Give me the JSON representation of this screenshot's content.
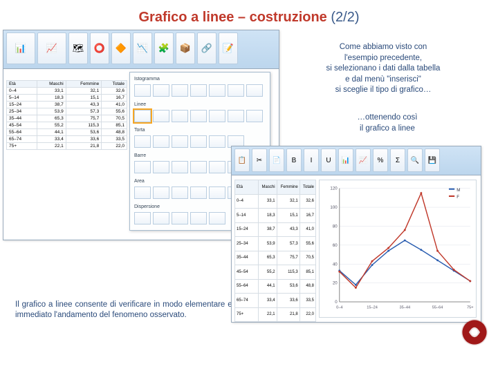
{
  "slide": {
    "title_main": "Grafico a linee – costruzione",
    "title_suffix": "(2/2)",
    "text1": "Come abbiamo visto con\nl'esempio precedente,\nsi selezionano i dati dalla tabella\ne dal menù \"inserisci\"\nsi sceglie il tipo di grafico…",
    "text2": "…ottenendo così\nil grafico a linee",
    "text3": "Il grafico a linee consente di verificare in modo elementare ed immediato l'andamento del fenomeno osservato."
  },
  "table": {
    "headers": [
      "Età",
      "Maschi",
      "Femmine",
      "Totale"
    ],
    "rows": [
      [
        "0–4",
        "33,1",
        "32,1",
        "32,6"
      ],
      [
        "5–14",
        "18,3",
        "15,1",
        "16,7"
      ],
      [
        "15–24",
        "38,7",
        "43,3",
        "41,0"
      ],
      [
        "25–34",
        "53,9",
        "57,3",
        "55,6"
      ],
      [
        "35–44",
        "65,3",
        "75,7",
        "70,5"
      ],
      [
        "45–54",
        "55,2",
        "115,3",
        "85,1"
      ],
      [
        "55–64",
        "44,1",
        "53,6",
        "48,8"
      ],
      [
        "65–74",
        "33,4",
        "33,6",
        "33,5"
      ],
      [
        "75+",
        "22,1",
        "21,8",
        "22,0"
      ]
    ]
  },
  "ribbon_icons_1": [
    "📊",
    "📈",
    "🗺",
    "⭕",
    "🔶",
    "📉",
    "🧩",
    "📦",
    "🔗",
    "📝"
  ],
  "ribbon_icons_2": [
    "📋",
    "✂",
    "📄",
    "B",
    "I",
    "U",
    "📊",
    "📈",
    "%",
    "Σ",
    "🔍",
    "💾"
  ],
  "chart_menu": {
    "sections": [
      {
        "label": "Istogramma",
        "thumbs": 7
      },
      {
        "label": "Linee",
        "thumbs": 7,
        "selected": 0
      },
      {
        "label": "Torta",
        "thumbs": 6
      },
      {
        "label": "Barre",
        "thumbs": 6
      },
      {
        "label": "Area",
        "thumbs": 6
      },
      {
        "label": "Dispersione",
        "thumbs": 5
      }
    ]
  },
  "chart_data": {
    "type": "line",
    "categories": [
      "0–4",
      "5–14",
      "15–24",
      "25–34",
      "35–44",
      "45–54",
      "55–64",
      "65–74",
      "75+"
    ],
    "series": [
      {
        "name": "M",
        "color": "#2a5db0",
        "values": [
          33,
          18,
          39,
          54,
          65,
          55,
          44,
          33,
          22
        ]
      },
      {
        "name": "F",
        "color": "#c0392b",
        "values": [
          32,
          15,
          43,
          57,
          76,
          115,
          54,
          34,
          22
        ]
      }
    ],
    "ylim": [
      0,
      120
    ],
    "xlabel": "",
    "ylabel": "",
    "title": ""
  }
}
